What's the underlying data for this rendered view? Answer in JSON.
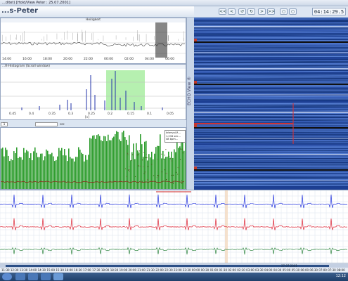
{
  "window": {
    "title_text": "...ditet) [Hold/View Peter : 25.07.2001]"
  },
  "patient": {
    "name": "...s-Peter"
  },
  "toolbar": {
    "buttons": [
      "<<",
      "<",
      "↺",
      "↻",
      ">",
      ">>",
      "○",
      "○"
    ],
    "clock": "04:14:29.5"
  },
  "trend_panel": {
    "title": "Heiligkeit",
    "x_ticks": [
      "14:00",
      "16:00",
      "18:00",
      "20:00",
      "22:00",
      "00:00",
      "02:00",
      "04:00",
      "06:00"
    ]
  },
  "histogram_panel": {
    "title": "...R-Histogram (Scroll window)",
    "x_ticks": [
      "0.45",
      "0.4",
      "0.35",
      "0.3",
      "0.25",
      "0.2",
      "0.15",
      "0.1",
      "0.05"
    ],
    "x_unit": "[s]"
  },
  "controls": {
    "dropdown_value": "1",
    "entry_unit": "sec"
  },
  "hr_panel": {
    "info_lines": [
      "Interval-R...",
      "1.234 sec...",
      "48 bpm..."
    ]
  },
  "side": {
    "vertical_label": "ECHO View ®"
  },
  "timeline": {
    "ticks": [
      "11:30",
      "12:30",
      "13:30",
      "14:00",
      "14:30",
      "15:00",
      "15:30",
      "16:00",
      "16:30",
      "17:00",
      "17:30",
      "18:00",
      "18:30",
      "19:00",
      "20:00",
      "21:00",
      "21:30",
      "22:00",
      "22:30",
      "23:00",
      "23:30",
      "00:00",
      "00:30",
      "01:00",
      "01:30",
      "02:00",
      "02:30",
      "03:00",
      "03:30",
      "04:00",
      "04:30",
      "05:00",
      "05:30",
      "06:00",
      "06:30",
      "07:00",
      "07:30",
      "08:00"
    ],
    "date_marker": "27.07.2001"
  },
  "taskbar": {
    "time": "12:12"
  },
  "colors": {
    "hr_green": "#2e9d2e",
    "ecg_blue": "#2233dd",
    "ecg_red": "#dd2233",
    "ecg_green": "#338844",
    "echo_bg": "#1d3f93",
    "highlight_green": "#b6f0b0"
  }
}
